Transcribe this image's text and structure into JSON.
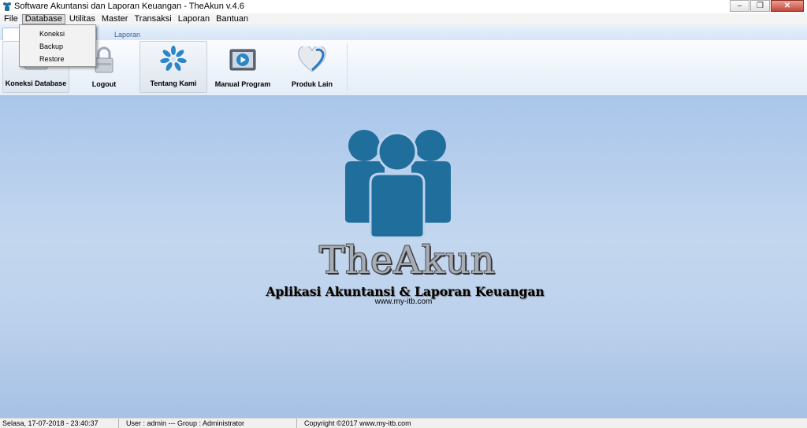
{
  "window": {
    "title": "Software Akuntansi dan Laporan Keuangan - TheAkun v.4.6",
    "minimize_glyph": "‒",
    "restore_glyph": "❐",
    "close_glyph": "✕"
  },
  "menu": {
    "items": [
      "File",
      "Database",
      "Utilitas",
      "Master",
      "Transaksi",
      "Laporan",
      "Bantuan"
    ],
    "active_index": 1
  },
  "dropdown": {
    "items": [
      "Koneksi",
      "Backup",
      "Restore"
    ]
  },
  "tabs": {
    "laporan": "Laporan"
  },
  "ribbon": {
    "buttons": [
      {
        "label": "Koneksi Database",
        "icon": "database-icon"
      },
      {
        "label": "Logout",
        "icon": "lock-icon"
      },
      {
        "label": "Tentang Kami",
        "icon": "flower-icon"
      },
      {
        "label": "Manual Program",
        "icon": "play-video-icon"
      },
      {
        "label": "Produk Lain",
        "icon": "heart-icon"
      }
    ]
  },
  "brand": {
    "name": "TheAkun",
    "tagline": "Aplikasi Akuntansi & Laporan Keuangan",
    "url": "www.my-itb.com"
  },
  "status": {
    "datetime": "Selasa, 17-07-2018 - 23:40:37",
    "user": "User : admin  --- Group : Administrator",
    "copyright": "Copyright ©2017 www.my-itb.com"
  },
  "colors": {
    "logo_blue": "#1f6e9c",
    "accent_blue": "#2a86c8"
  }
}
